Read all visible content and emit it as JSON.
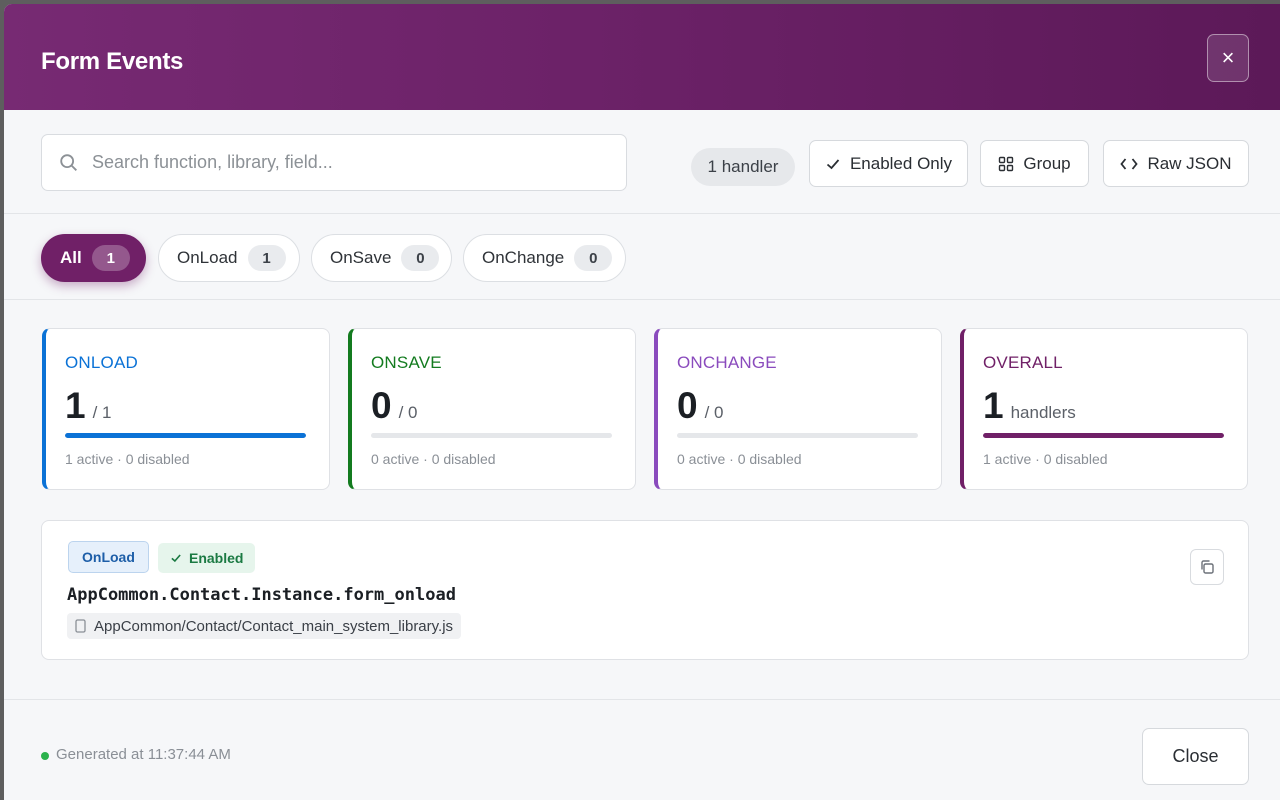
{
  "modal": {
    "title": "Form Events",
    "close_icon": "×"
  },
  "toolbar": {
    "search_placeholder": "Search function, library, field...",
    "handler_count": "1 handler",
    "enabled_only_label": "Enabled Only",
    "group_label": "Group",
    "raw_json_label": "Raw JSON"
  },
  "tabs": [
    {
      "label": "All",
      "count": "1",
      "active": true
    },
    {
      "label": "OnLoad",
      "count": "1"
    },
    {
      "label": "OnSave",
      "count": "0"
    },
    {
      "label": "OnChange",
      "count": "0"
    }
  ],
  "stats": [
    {
      "label": "ONLOAD",
      "value": "1",
      "suffix": "/ 1",
      "meta": "1 active · 0 disabled",
      "color": "#0b72d6",
      "progress": 1
    },
    {
      "label": "ONSAVE",
      "value": "0",
      "suffix": "/ 0",
      "meta": "0 active · 0 disabled",
      "color": "#137b1f",
      "progress": 0
    },
    {
      "label": "ONCHANGE",
      "value": "0",
      "suffix": "/ 0",
      "meta": "0 active · 0 disabled",
      "color": "#8a4bbd",
      "progress": 0
    },
    {
      "label": "OVERALL",
      "value": "1",
      "suffix": "handlers",
      "meta": "1 active · 0 disabled",
      "color": "#702067",
      "progress": 1
    }
  ],
  "handler": {
    "event": "OnLoad",
    "status": "Enabled",
    "function_name": "AppCommon.Contact.Instance.form_onload",
    "library": "AppCommon/Contact/Contact_main_system_library.js"
  },
  "footer": {
    "generated": "Generated at 11:37:44 AM",
    "close_label": "Close"
  },
  "colors": {
    "brand": "#702067",
    "enabled": "#1b7a43",
    "status_dot": "#2bb24c"
  }
}
